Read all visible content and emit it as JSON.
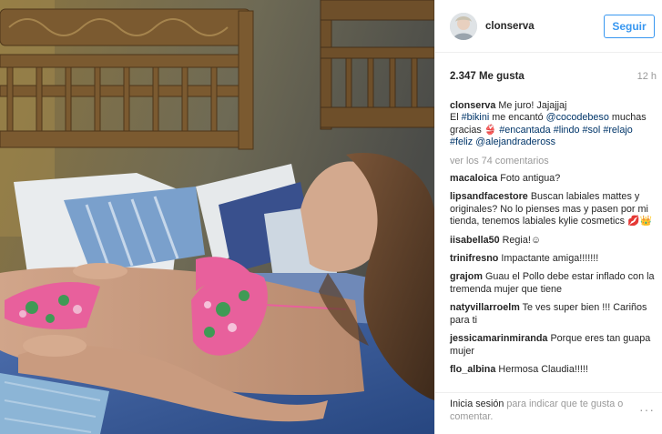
{
  "post": {
    "username": "clonserva",
    "follow_label": "Seguir",
    "likes": "2.347 Me gusta",
    "time": "12 h"
  },
  "caption": {
    "user": "clonserva",
    "text_1": "Me juro! Jajajjaj",
    "text_2": "El ",
    "tag_bikini": "#bikini",
    "text_3": " me encantó ",
    "mention_1": "@cocodebeso",
    "text_4": " muchas gracias 👙 ",
    "tag_encantada": "#encantada",
    "tag_lindo": "#lindo",
    "tag_sol": "#sol",
    "tag_relajo": "#relajo",
    "tag_feliz": "#feliz",
    "mention_2": "@alejandradeross"
  },
  "view_all": "ver los 74 comentarios",
  "comments": [
    {
      "user": "macaloica",
      "text": "Foto antigua?"
    },
    {
      "user": "lipsandfacestore",
      "text": "Buscan labiales mattes y originales? No lo pienses mas y pasen por mi tienda, tenemos labiales kylie cosmetics 💋👑"
    },
    {
      "user": "iisabella50",
      "text": "Regia!☺"
    },
    {
      "user": "trinifresno",
      "text": "Impactante amiga!!!!!!!"
    },
    {
      "user": "grajom",
      "text": "Guau el Pollo debe estar inflado con la tremenda mujer que tiene"
    },
    {
      "user": "natyvillarroelm",
      "text": "Te ves super bien !!! Cariños para ti"
    },
    {
      "user": "jessicamarinmiranda",
      "text": "Porque eres tan guapa mujer"
    },
    {
      "user": "flo_albina",
      "text": "Hermosa Claudia!!!!!"
    }
  ],
  "footer": {
    "login_link": "Inicia sesión",
    "login_text": " para indicar que te gusta o comentar.",
    "more_icon": "···"
  },
  "icons": {
    "more": "more-options-icon"
  },
  "colors": {
    "accent": "#3897f0",
    "hashtag": "#003569",
    "muted": "#999999"
  }
}
